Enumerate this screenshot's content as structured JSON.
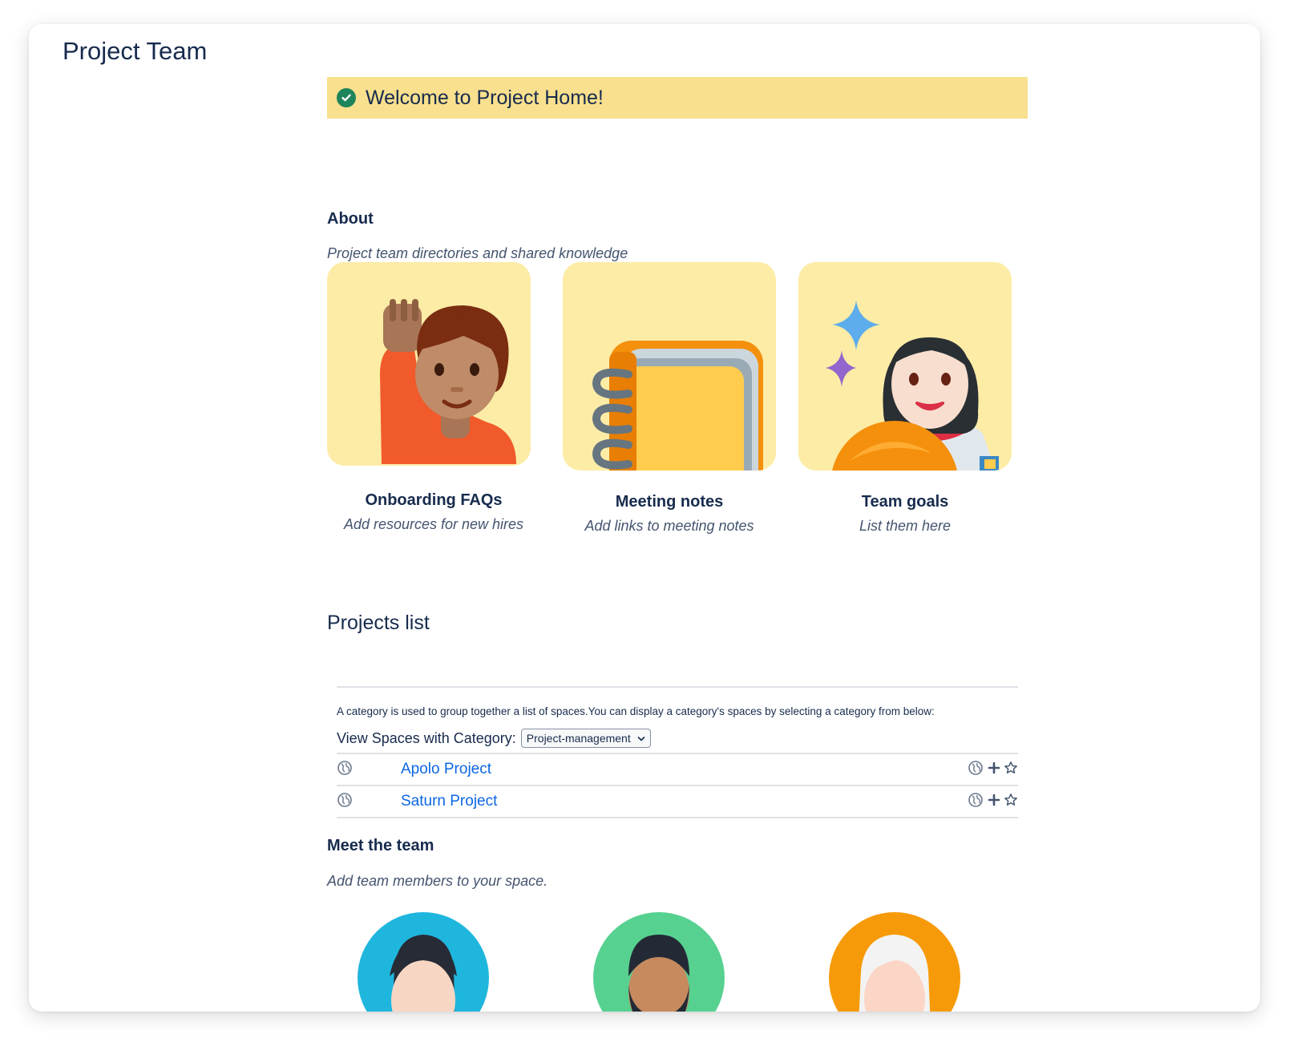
{
  "space": {
    "title": "Project Team"
  },
  "banner": {
    "text": "Welcome to Project Home!"
  },
  "about": {
    "heading": "About",
    "description": "Project team directories and shared knowledge"
  },
  "cards": [
    {
      "title": "Onboarding FAQs",
      "subtitle": "Add resources for new hires"
    },
    {
      "title": "Meeting notes",
      "subtitle": "Add links to meeting notes"
    },
    {
      "title": "Team goals",
      "subtitle": "List them here"
    }
  ],
  "projects": {
    "heading": "Projects list",
    "description": "A category is used to group together a list of spaces.You can display a category's spaces by selecting a category from below:",
    "filter_label": "View Spaces with Category:",
    "selected_category": "Project-management",
    "rows": [
      {
        "name": "Apolo Project"
      },
      {
        "name": "Saturn Project"
      }
    ]
  },
  "team": {
    "heading": "Meet the team",
    "description": "Add team members to your space."
  },
  "colors": {
    "banner": "#f8e08e",
    "card_bg": "#fceca6",
    "link": "#0c66e4",
    "success": "#1f845a",
    "avatar_1": "#1fb6de",
    "avatar_2": "#57d190",
    "avatar_3": "#f79a09"
  }
}
